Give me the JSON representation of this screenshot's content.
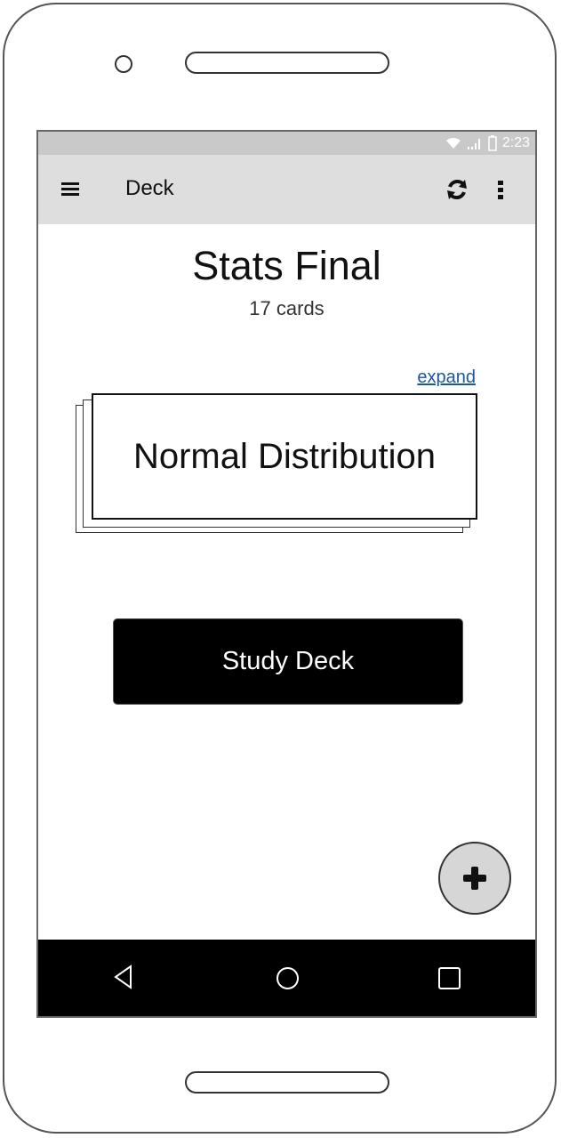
{
  "status_bar": {
    "time": "2:23",
    "icons": [
      "wifi-icon",
      "signal-icon",
      "battery-icon"
    ]
  },
  "app_bar": {
    "title": "Deck",
    "icons": [
      "menu-icon",
      "sync-icon",
      "more-vertical-icon"
    ]
  },
  "deck": {
    "title": "Stats Final",
    "card_count": "17 cards"
  },
  "card": {
    "expand_label": "expand",
    "front_text": "Normal Distribution"
  },
  "actions": {
    "study_label": "Study Deck",
    "fab_icon": "plus-icon"
  },
  "nav_bar": {
    "icons": [
      "back-icon",
      "home-icon",
      "recent-apps-icon"
    ]
  },
  "colors": {
    "status_bar": "#c9c9c9",
    "app_bar": "#dedede",
    "link": "#1a57a3",
    "button": "#000000",
    "fab": "#d6d6d6"
  }
}
